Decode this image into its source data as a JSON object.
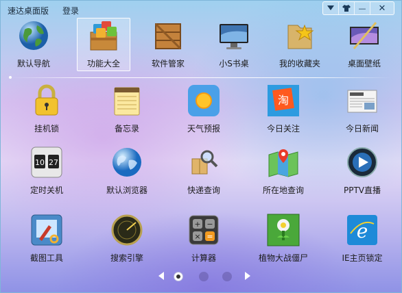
{
  "menu": {
    "app_title": "速达桌面版",
    "login": "登录"
  },
  "window_controls": {
    "dropdown_icon": "chevron-down-icon",
    "skin_icon": "shirt-icon",
    "minimize": "—",
    "close": "✕"
  },
  "top_items": [
    {
      "label": "默认导航",
      "icon": "globe-icon"
    },
    {
      "label": "功能大全",
      "icon": "app-box-icon"
    },
    {
      "label": "软件管家",
      "icon": "crate-icon"
    },
    {
      "label": "小S书桌",
      "icon": "monitor-icon"
    },
    {
      "label": "我的收藏夹",
      "icon": "star-folder-icon"
    },
    {
      "label": "桌面壁纸",
      "icon": "wallpaper-icon"
    }
  ],
  "grid_items": [
    {
      "label": "挂机锁",
      "icon": "padlock-icon"
    },
    {
      "label": "备忘录",
      "icon": "notepad-icon"
    },
    {
      "label": "天气预报",
      "icon": "weather-icon"
    },
    {
      "label": "今日关注",
      "icon": "taobao-icon"
    },
    {
      "label": "今日新闻",
      "icon": "newspaper-icon"
    },
    {
      "label": "定时关机",
      "icon": "flip-clock-icon"
    },
    {
      "label": "默认浏览器",
      "icon": "browser-globe-icon"
    },
    {
      "label": "快递查询",
      "icon": "parcel-search-icon"
    },
    {
      "label": "所在地查询",
      "icon": "map-pin-icon"
    },
    {
      "label": "PPTV直播",
      "icon": "pptv-icon"
    },
    {
      "label": "截图工具",
      "icon": "screenshot-icon"
    },
    {
      "label": "搜索引擎",
      "icon": "radar-icon"
    },
    {
      "label": "计算器",
      "icon": "calculator-icon"
    },
    {
      "label": "植物大战僵尸",
      "icon": "plants-zombies-icon"
    },
    {
      "label": "IE主页锁定",
      "icon": "ie-icon"
    }
  ],
  "pager": {
    "pages": 3,
    "current": 1
  },
  "selected_top_item": "功能大全"
}
